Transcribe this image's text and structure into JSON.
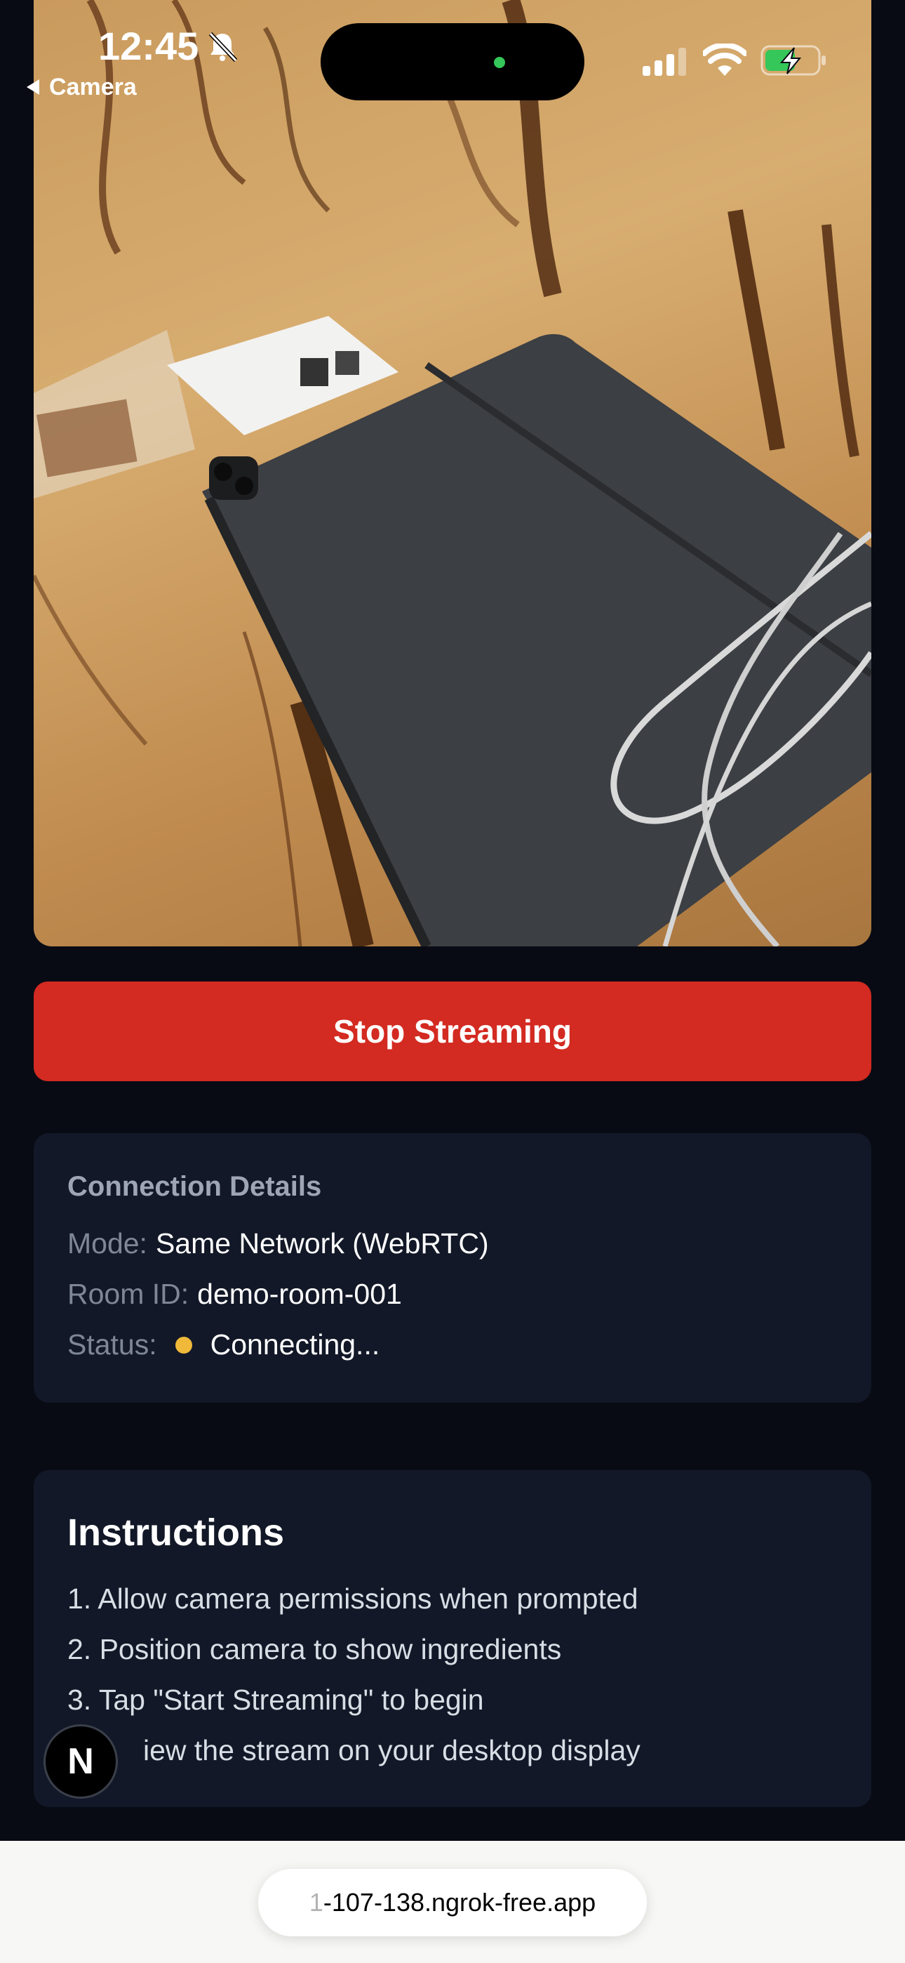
{
  "status_bar": {
    "time": "12:45",
    "back_label": "Camera",
    "icons": [
      "bell-slash-icon",
      "signal-icon",
      "wifi-icon",
      "battery-charging-icon"
    ]
  },
  "stream_button": {
    "label": "Stop Streaming",
    "color": "#d32a21"
  },
  "connection": {
    "heading": "Connection Details",
    "mode_label": "Mode:",
    "mode_value": "Same Network (WebRTC)",
    "room_label": "Room ID:",
    "room_value": "demo-room-001",
    "status_label": "Status:",
    "status_value": "Connecting...",
    "status_color": "#f0b93a"
  },
  "instructions": {
    "heading": "Instructions",
    "steps": [
      "1. Allow camera permissions when prompted",
      "2. Position camera to show ingredients",
      "3. Tap \"Start Streaming\" to begin",
      "iew the stream on your desktop display"
    ]
  },
  "dev_badge": {
    "letter": "N"
  },
  "browser": {
    "url_prefix": "1",
    "url": "-107-138.ngrok-free.app"
  }
}
